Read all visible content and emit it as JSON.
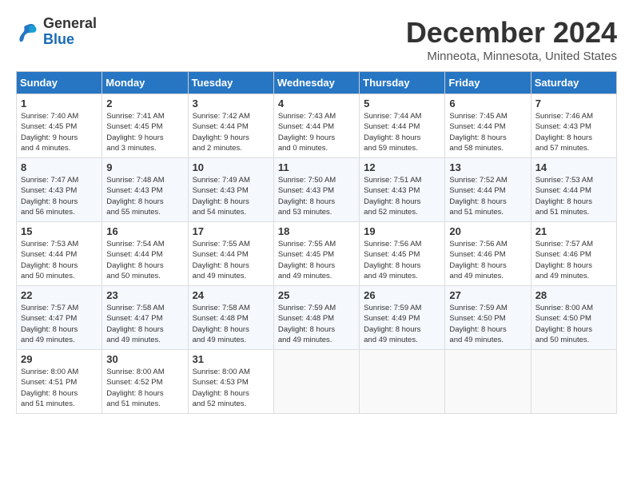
{
  "header": {
    "logo_general": "General",
    "logo_blue": "Blue",
    "title": "December 2024",
    "location": "Minneota, Minnesota, United States"
  },
  "calendar": {
    "weekdays": [
      "Sunday",
      "Monday",
      "Tuesday",
      "Wednesday",
      "Thursday",
      "Friday",
      "Saturday"
    ],
    "weeks": [
      [
        {
          "day": 1,
          "lines": [
            "Sunrise: 7:40 AM",
            "Sunset: 4:45 PM",
            "Daylight: 9 hours",
            "and 4 minutes."
          ]
        },
        {
          "day": 2,
          "lines": [
            "Sunrise: 7:41 AM",
            "Sunset: 4:45 PM",
            "Daylight: 9 hours",
            "and 3 minutes."
          ]
        },
        {
          "day": 3,
          "lines": [
            "Sunrise: 7:42 AM",
            "Sunset: 4:44 PM",
            "Daylight: 9 hours",
            "and 2 minutes."
          ]
        },
        {
          "day": 4,
          "lines": [
            "Sunrise: 7:43 AM",
            "Sunset: 4:44 PM",
            "Daylight: 9 hours",
            "and 0 minutes."
          ]
        },
        {
          "day": 5,
          "lines": [
            "Sunrise: 7:44 AM",
            "Sunset: 4:44 PM",
            "Daylight: 8 hours",
            "and 59 minutes."
          ]
        },
        {
          "day": 6,
          "lines": [
            "Sunrise: 7:45 AM",
            "Sunset: 4:44 PM",
            "Daylight: 8 hours",
            "and 58 minutes."
          ]
        },
        {
          "day": 7,
          "lines": [
            "Sunrise: 7:46 AM",
            "Sunset: 4:43 PM",
            "Daylight: 8 hours",
            "and 57 minutes."
          ]
        }
      ],
      [
        {
          "day": 8,
          "lines": [
            "Sunrise: 7:47 AM",
            "Sunset: 4:43 PM",
            "Daylight: 8 hours",
            "and 56 minutes."
          ]
        },
        {
          "day": 9,
          "lines": [
            "Sunrise: 7:48 AM",
            "Sunset: 4:43 PM",
            "Daylight: 8 hours",
            "and 55 minutes."
          ]
        },
        {
          "day": 10,
          "lines": [
            "Sunrise: 7:49 AM",
            "Sunset: 4:43 PM",
            "Daylight: 8 hours",
            "and 54 minutes."
          ]
        },
        {
          "day": 11,
          "lines": [
            "Sunrise: 7:50 AM",
            "Sunset: 4:43 PM",
            "Daylight: 8 hours",
            "and 53 minutes."
          ]
        },
        {
          "day": 12,
          "lines": [
            "Sunrise: 7:51 AM",
            "Sunset: 4:43 PM",
            "Daylight: 8 hours",
            "and 52 minutes."
          ]
        },
        {
          "day": 13,
          "lines": [
            "Sunrise: 7:52 AM",
            "Sunset: 4:44 PM",
            "Daylight: 8 hours",
            "and 51 minutes."
          ]
        },
        {
          "day": 14,
          "lines": [
            "Sunrise: 7:53 AM",
            "Sunset: 4:44 PM",
            "Daylight: 8 hours",
            "and 51 minutes."
          ]
        }
      ],
      [
        {
          "day": 15,
          "lines": [
            "Sunrise: 7:53 AM",
            "Sunset: 4:44 PM",
            "Daylight: 8 hours",
            "and 50 minutes."
          ]
        },
        {
          "day": 16,
          "lines": [
            "Sunrise: 7:54 AM",
            "Sunset: 4:44 PM",
            "Daylight: 8 hours",
            "and 50 minutes."
          ]
        },
        {
          "day": 17,
          "lines": [
            "Sunrise: 7:55 AM",
            "Sunset: 4:44 PM",
            "Daylight: 8 hours",
            "and 49 minutes."
          ]
        },
        {
          "day": 18,
          "lines": [
            "Sunrise: 7:55 AM",
            "Sunset: 4:45 PM",
            "Daylight: 8 hours",
            "and 49 minutes."
          ]
        },
        {
          "day": 19,
          "lines": [
            "Sunrise: 7:56 AM",
            "Sunset: 4:45 PM",
            "Daylight: 8 hours",
            "and 49 minutes."
          ]
        },
        {
          "day": 20,
          "lines": [
            "Sunrise: 7:56 AM",
            "Sunset: 4:46 PM",
            "Daylight: 8 hours",
            "and 49 minutes."
          ]
        },
        {
          "day": 21,
          "lines": [
            "Sunrise: 7:57 AM",
            "Sunset: 4:46 PM",
            "Daylight: 8 hours",
            "and 49 minutes."
          ]
        }
      ],
      [
        {
          "day": 22,
          "lines": [
            "Sunrise: 7:57 AM",
            "Sunset: 4:47 PM",
            "Daylight: 8 hours",
            "and 49 minutes."
          ]
        },
        {
          "day": 23,
          "lines": [
            "Sunrise: 7:58 AM",
            "Sunset: 4:47 PM",
            "Daylight: 8 hours",
            "and 49 minutes."
          ]
        },
        {
          "day": 24,
          "lines": [
            "Sunrise: 7:58 AM",
            "Sunset: 4:48 PM",
            "Daylight: 8 hours",
            "and 49 minutes."
          ]
        },
        {
          "day": 25,
          "lines": [
            "Sunrise: 7:59 AM",
            "Sunset: 4:48 PM",
            "Daylight: 8 hours",
            "and 49 minutes."
          ]
        },
        {
          "day": 26,
          "lines": [
            "Sunrise: 7:59 AM",
            "Sunset: 4:49 PM",
            "Daylight: 8 hours",
            "and 49 minutes."
          ]
        },
        {
          "day": 27,
          "lines": [
            "Sunrise: 7:59 AM",
            "Sunset: 4:50 PM",
            "Daylight: 8 hours",
            "and 49 minutes."
          ]
        },
        {
          "day": 28,
          "lines": [
            "Sunrise: 8:00 AM",
            "Sunset: 4:50 PM",
            "Daylight: 8 hours",
            "and 50 minutes."
          ]
        }
      ],
      [
        {
          "day": 29,
          "lines": [
            "Sunrise: 8:00 AM",
            "Sunset: 4:51 PM",
            "Daylight: 8 hours",
            "and 51 minutes."
          ]
        },
        {
          "day": 30,
          "lines": [
            "Sunrise: 8:00 AM",
            "Sunset: 4:52 PM",
            "Daylight: 8 hours",
            "and 51 minutes."
          ]
        },
        {
          "day": 31,
          "lines": [
            "Sunrise: 8:00 AM",
            "Sunset: 4:53 PM",
            "Daylight: 8 hours",
            "and 52 minutes."
          ]
        },
        null,
        null,
        null,
        null
      ]
    ]
  }
}
